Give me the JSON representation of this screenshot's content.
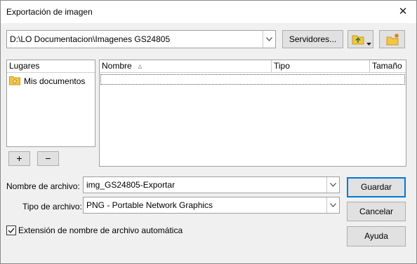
{
  "window": {
    "title": "Exportación de imagen",
    "close_icon": "close-icon"
  },
  "path": {
    "value": "D:\\LO Documentacion\\Imagenes GS24805"
  },
  "toolbar": {
    "servers_label": "Servidores...",
    "up_icon": "folder-up-icon",
    "new_folder_icon": "new-folder-icon"
  },
  "places": {
    "header": "Lugares",
    "items": [
      {
        "label": "Mis documentos",
        "icon": "folder-star-icon"
      }
    ],
    "add_label": "+",
    "remove_label": "−"
  },
  "files": {
    "columns": [
      "Nombre",
      "Tipo",
      "Tamaño"
    ],
    "sort_indicator": "∆"
  },
  "filename": {
    "label": "Nombre de archivo:",
    "value": "img_GS24805-Exportar"
  },
  "filetype": {
    "label": "Tipo de archivo:",
    "value": "PNG - Portable Network Graphics"
  },
  "auto_ext": {
    "label": "Extensión de nombre de archivo automática",
    "checked": true
  },
  "actions": {
    "save_label": "Guardar",
    "cancel_label": "Cancelar",
    "help_label": "Ayuda"
  },
  "colors": {
    "accent": "#0078d7",
    "folder": "#f5c542"
  }
}
